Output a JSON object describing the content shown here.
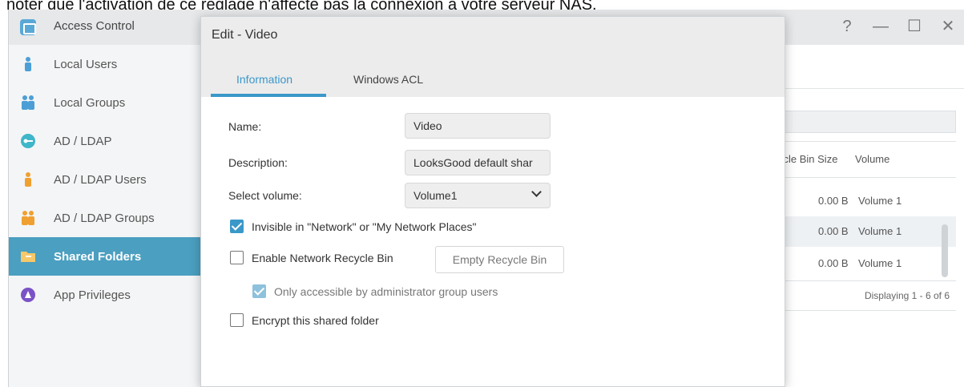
{
  "caption": "noter que l'activation de ce réglage n'affecte pas la connexion à votre serveur NAS.",
  "app": {
    "title": "Access Control",
    "controls": {
      "help": "?",
      "minimize": "—",
      "maximize": "☐",
      "close": "✕"
    }
  },
  "sidebar": {
    "items": [
      {
        "label": "Local Users",
        "icon": "user-icon",
        "color": "#4b9fd6"
      },
      {
        "label": "Local Groups",
        "icon": "users-icon",
        "color": "#4b9fd6"
      },
      {
        "label": "AD / LDAP",
        "icon": "key-icon",
        "color": "#3fb6c9"
      },
      {
        "label": "AD / LDAP Users",
        "icon": "user-icon",
        "color": "#f0a030"
      },
      {
        "label": "AD / LDAP Groups",
        "icon": "users-icon",
        "color": "#f0a030"
      },
      {
        "label": "Shared Folders",
        "icon": "folder-icon",
        "color": "#f5c86a",
        "active": true
      },
      {
        "label": "App Privileges",
        "icon": "app-privileges-icon",
        "color": "#7b52c7"
      }
    ]
  },
  "table": {
    "headers": {
      "size": "ycle Bin Size",
      "volume": "Volume"
    },
    "rows": [
      {
        "size": "0.00 B",
        "volume": "Volume 1"
      },
      {
        "size": "0.00 B",
        "volume": "Volume 1"
      },
      {
        "size": "0.00 B",
        "volume": "Volume 1"
      }
    ],
    "footer": "Displaying 1 - 6 of 6"
  },
  "dialog": {
    "title": "Edit - Video",
    "tabs": [
      "Information",
      "Windows ACL"
    ],
    "fields": {
      "name": {
        "label": "Name:",
        "value": "Video"
      },
      "description": {
        "label": "Description:",
        "value": "LooksGood default shar"
      },
      "volume": {
        "label": "Select volume:",
        "value": "Volume1"
      }
    },
    "options": {
      "invisible": {
        "label": "Invisible in \"Network\" or \"My Network Places\"",
        "checked": true
      },
      "recycle": {
        "label": "Enable Network Recycle Bin",
        "checked": false
      },
      "empty_recycle": "Empty Recycle Bin",
      "admin_only": {
        "label": "Only accessible by administrator group users",
        "checked": true,
        "disabled": true
      },
      "encrypt": {
        "label": "Encrypt this shared folder",
        "checked": false
      }
    }
  },
  "colors": {
    "accent": "#3a98c9",
    "sidebar_active": "#4b9fc0"
  }
}
